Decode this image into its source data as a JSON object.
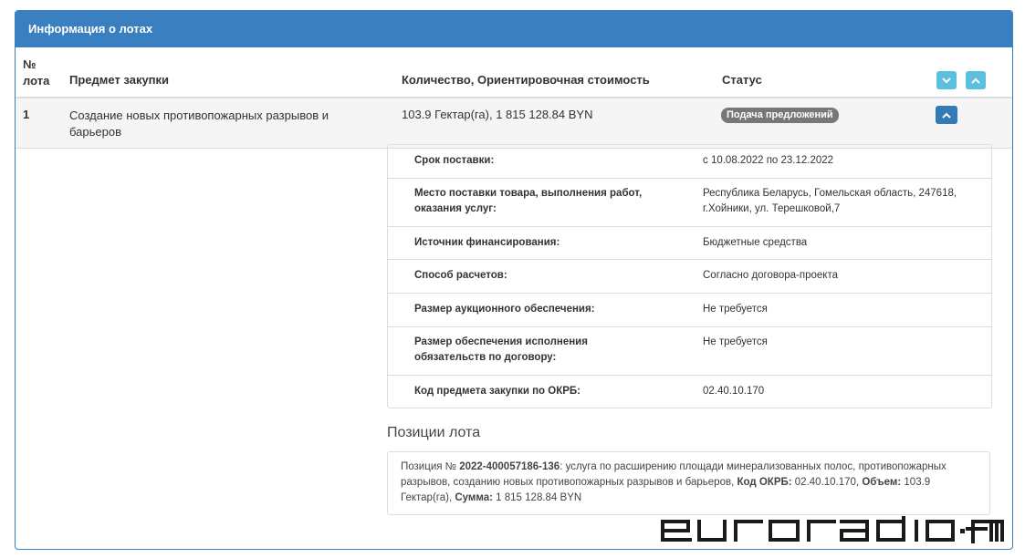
{
  "panel": {
    "title": "Информация о лотах"
  },
  "table": {
    "headers": {
      "num_line1": "№",
      "num_line2": "лота",
      "subject": "Предмет закупки",
      "quantity": "Количество, Ориентировочная стоимость",
      "status": "Статус"
    },
    "row": {
      "num": "1",
      "subject": "Создание новых противопожарных разрывов и барьеров",
      "quantity": "103.9 Гектар(га), 1 815 128.84 BYN",
      "status": "Подача предложений"
    }
  },
  "details": [
    {
      "label": "Срок поставки:",
      "value": "с 10.08.2022 по 23.12.2022"
    },
    {
      "label": "Место поставки товара, выполнения работ, оказания услуг:",
      "value": "Республика Беларусь, Гомельская область, 247618, г.Хойники, ул. Терешковой,7"
    },
    {
      "label": "Источник финансирования:",
      "value": "Бюджетные средства"
    },
    {
      "label": "Способ расчетов:",
      "value": "Согласно договора-проекта"
    },
    {
      "label": "Размер аукционного обеспечения:",
      "value": "Не требуется"
    },
    {
      "label": "Размер обеспечения исполнения обязательств по договору:",
      "value": "Не требуется"
    },
    {
      "label": "Код предмета закупки по ОКРБ:",
      "value": "02.40.10.170"
    }
  ],
  "positions": {
    "title": "Позиции лота",
    "prefix": "Позиция № ",
    "number": "2022-400057186-136",
    "description": ": услуга по расширению площади минерализованных полос, противопожарных разрывов, созданию новых противопожарных разрывов и барьеров, ",
    "okrb_label": "Код ОКРБ:",
    "okrb_value": " 02.40.10.170, ",
    "volume_label": "Объем:",
    "volume_value": " 103.9 Гектар(га), ",
    "sum_label": "Сумма:",
    "sum_value": " 1 815 128.84 BYN"
  },
  "watermark": {
    "text": "euroradio·fm",
    "color": "#1a1a1a"
  },
  "colors": {
    "accent": "#3a7fbf",
    "info_button": "#5bc0de",
    "primary_button": "#337ab7",
    "badge": "#777777"
  },
  "icons": {
    "expand": "chevron-down-icon",
    "collapse": "chevron-up-icon"
  }
}
